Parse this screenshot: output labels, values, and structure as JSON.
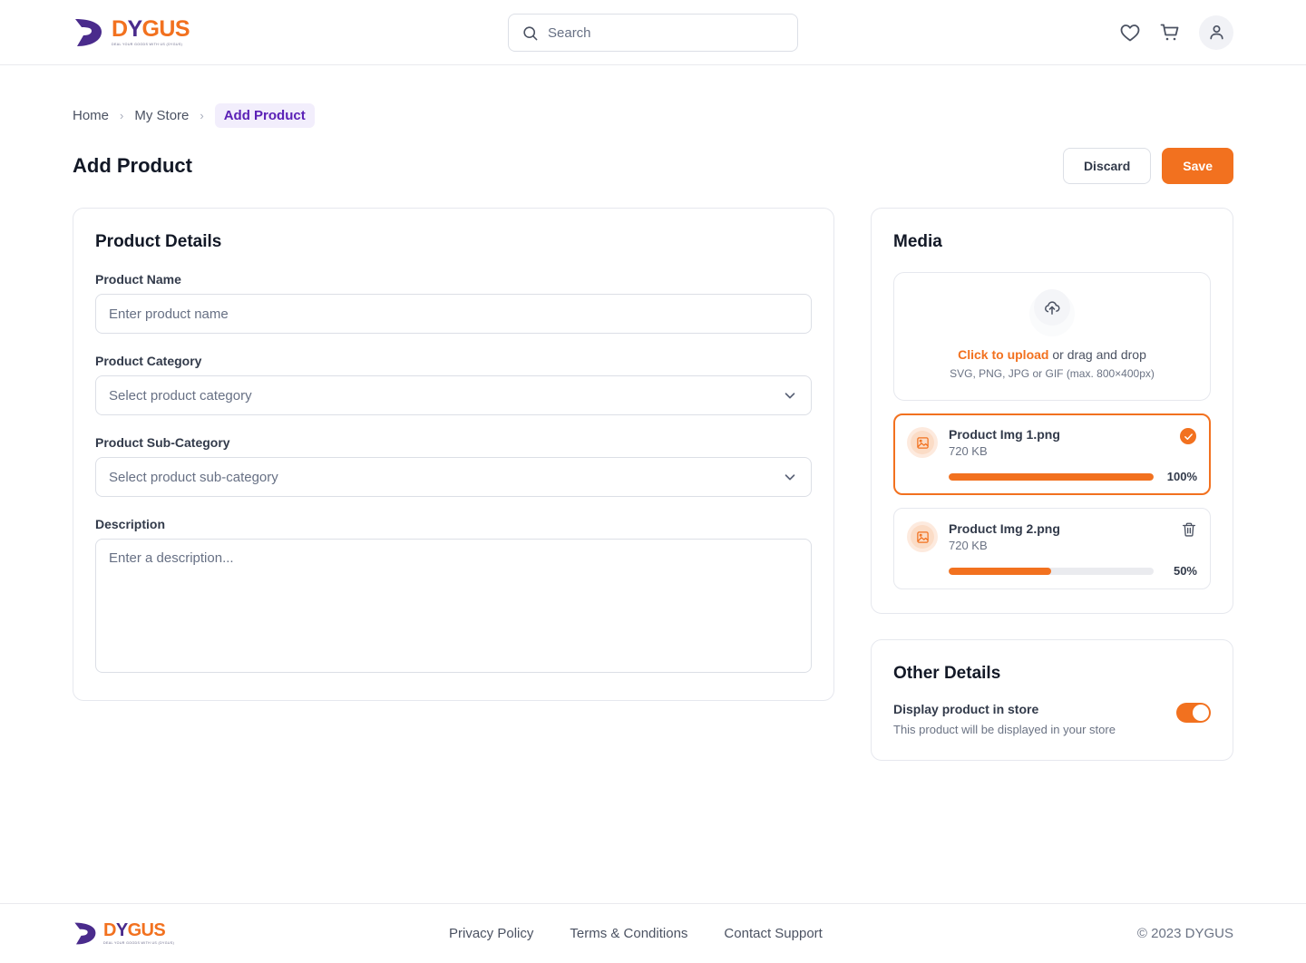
{
  "brand": {
    "name_part1": "D",
    "name_tick": "Y",
    "name_part2": "GUS",
    "full_name": "DYGUS",
    "tagline": "DEAL YOUR GOODS WITH US (DYGUS)"
  },
  "header": {
    "search": {
      "placeholder": "Search",
      "value": ""
    },
    "icons": {
      "wishlist": "heart-icon",
      "cart": "cart-icon",
      "account": "user-icon",
      "search": "search-icon"
    }
  },
  "breadcrumb": {
    "items": [
      {
        "label": "Home",
        "current": false
      },
      {
        "label": "My Store",
        "current": false
      },
      {
        "label": "Add Product",
        "current": true
      }
    ],
    "separator": "›"
  },
  "page": {
    "title": "Add Product",
    "discard_label": "Discard",
    "save_label": "Save"
  },
  "product_details": {
    "heading": "Product Details",
    "fields": {
      "name": {
        "label": "Product Name",
        "placeholder": "Enter product name",
        "value": ""
      },
      "category": {
        "label": "Product Category",
        "placeholder": "Select product category",
        "value": ""
      },
      "subcategory": {
        "label": "Product Sub-Category",
        "placeholder": "Select product sub-category",
        "value": ""
      },
      "description": {
        "label": "Description",
        "placeholder": "Enter a description...",
        "value": ""
      }
    }
  },
  "media": {
    "heading": "Media",
    "dropzone": {
      "icon": "cloud-upload-icon",
      "action_text": "Click to upload",
      "rest_text": " or drag and drop",
      "hint": "SVG, PNG, JPG or GIF (max. 800×400px)"
    },
    "files": [
      {
        "name": "Product Img 1.png",
        "size": "720 KB",
        "progress": 100,
        "progress_label": "100%",
        "state": "complete",
        "action_icon": "check-circle-icon",
        "selected": true
      },
      {
        "name": "Product Img 2.png",
        "size": "720 KB",
        "progress": 50,
        "progress_label": "50%",
        "state": "uploading",
        "action_icon": "trash-icon",
        "selected": false
      }
    ]
  },
  "other_details": {
    "heading": "Other Details",
    "toggle": {
      "label": "Display product in store",
      "description": "This product will be displayed in your store",
      "enabled": true
    }
  },
  "footer": {
    "links": [
      "Privacy Policy",
      "Terms & Conditions",
      "Contact Support"
    ],
    "copyright": "© 2023 DYGUS"
  },
  "colors": {
    "accent": "#f2711f",
    "brand_purple": "#4a2b8c",
    "breadcrumb_current": "#5b21b6",
    "text_dark": "#121826",
    "text_muted": "#6b7384",
    "border": "#e6e8ee"
  }
}
